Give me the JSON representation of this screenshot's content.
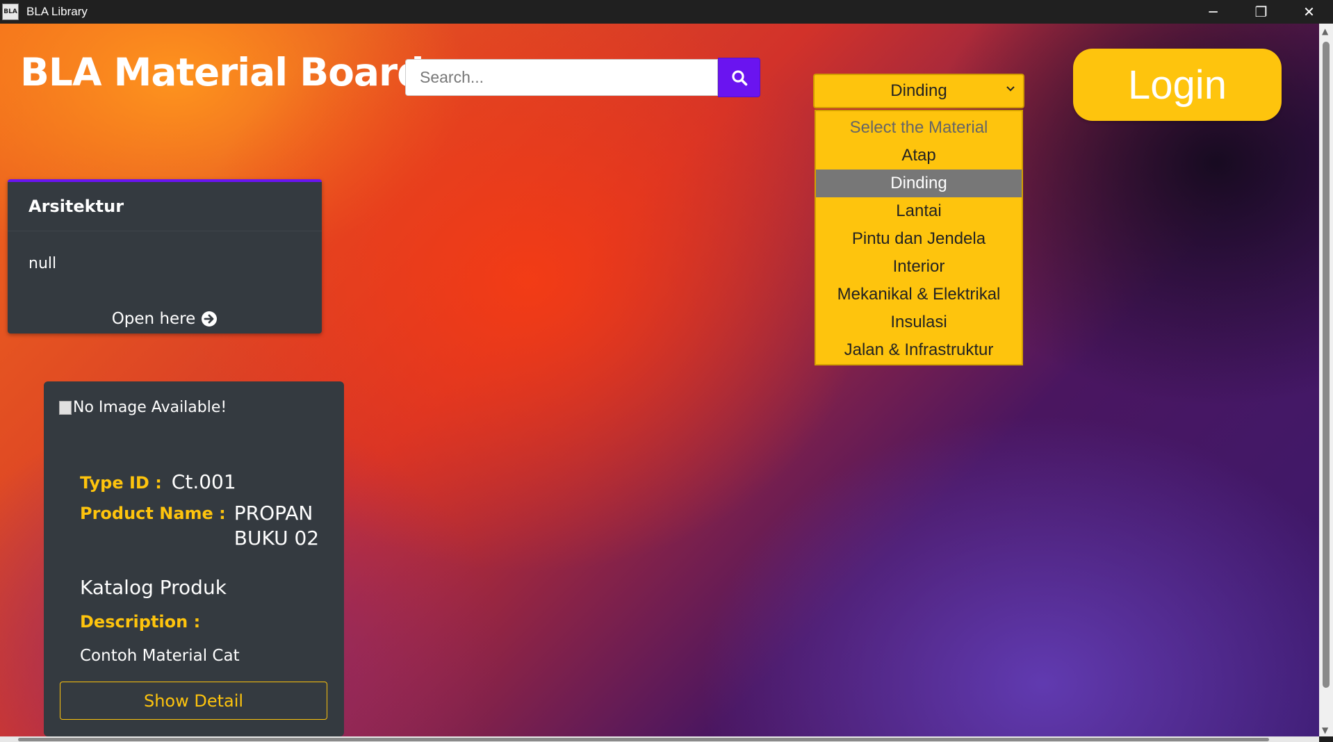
{
  "window": {
    "title": "BLA Library",
    "icon_text": "BLA",
    "controls": {
      "minimize": "─",
      "restore": "❐",
      "close": "✕"
    }
  },
  "header": {
    "brand": "BLA Material Board",
    "search": {
      "placeholder": "Search...",
      "value": ""
    },
    "login_label": "Login"
  },
  "material_select": {
    "selected": "Dinding",
    "options": [
      {
        "label": "Select the Material",
        "placeholder": true
      },
      {
        "label": "Atap"
      },
      {
        "label": "Dinding",
        "selected": true
      },
      {
        "label": "Lantai"
      },
      {
        "label": "Pintu dan Jendela"
      },
      {
        "label": "Interior"
      },
      {
        "label": "Mekanikal & Elektrikal"
      },
      {
        "label": "Insulasi"
      },
      {
        "label": "Jalan & Infrastruktur"
      }
    ]
  },
  "category_card": {
    "title": "Arsitektur",
    "body": "null",
    "link": "Open here"
  },
  "product_card": {
    "image_alt": "No Image Available!",
    "type_label": "Type ID :",
    "type_value": "Ct.001",
    "name_label": "Product Name :",
    "name_value": "PROPAN BUKU 02",
    "extra_title": "Katalog Produk",
    "description_label": "Description :",
    "description_value": "Contoh Material Cat",
    "button": "Show Detail"
  },
  "colors": {
    "accent_yellow": "#fec40d",
    "accent_purple": "#6a14f0",
    "card_bg": "#343a40"
  }
}
